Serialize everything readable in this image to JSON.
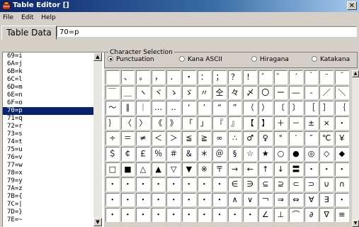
{
  "window": {
    "title": "Table Editor []",
    "close_glyph": "✕"
  },
  "menu": [
    "File",
    "Edit",
    "Help"
  ],
  "tab": {
    "label": "Table Data",
    "value": "70=p"
  },
  "list": {
    "items": [
      "69=i",
      "6A=j",
      "6B=k",
      "6C=l",
      "6D=m",
      "6E=n",
      "6F=o",
      "70=p",
      "71=q",
      "72=r",
      "73=s",
      "74=t",
      "75=u",
      "76=v",
      "77=w",
      "78=x",
      "79=y",
      "7A=z",
      "7B={",
      "7C=|",
      "7D=}",
      "7E=~"
    ],
    "selected_index": 7
  },
  "selection": {
    "group_label": "Character Selection",
    "options": [
      "Punctuation",
      "Kana ASCII",
      "Hiragana",
      "Katakana"
    ],
    "selected_index": 0
  },
  "grid": {
    "rows": [
      [
        "　",
        "、",
        "。",
        "，",
        "．",
        "・",
        "：",
        "；",
        "？",
        "！",
        "゛",
        "゜",
        "´",
        "｀",
        "¨",
        "＾"
      ],
      [
        "￣",
        "＿",
        "ヽ",
        "ヾ",
        "ゝ",
        "ゞ",
        "〃",
        "仝",
        "々",
        "〆",
        "〇",
        "ー",
        "―",
        "‐",
        "／",
        "＼"
      ],
      [
        "～",
        "∥",
        "｜",
        "…",
        "‥",
        "‘",
        "’",
        "“",
        "”",
        "（",
        "）",
        "〔",
        "〕",
        "［",
        "］",
        "｛"
      ],
      [
        "｝",
        "〈",
        "〉",
        "《",
        "》",
        "「",
        "」",
        "『",
        "』",
        "【",
        "】",
        "＋",
        "－",
        "±",
        "×",
        "・"
      ],
      [
        "÷",
        "＝",
        "≠",
        "＜",
        "＞",
        "≦",
        "≧",
        "∞",
        "∴",
        "♂",
        "♀",
        "°",
        "′",
        "″",
        "℃",
        "￥"
      ],
      [
        "＄",
        "￠",
        "￡",
        "％",
        "＃",
        "＆",
        "＊",
        "＠",
        "§",
        "☆",
        "★",
        "○",
        "●",
        "◎",
        "◇",
        "◆"
      ],
      [
        "□",
        "■",
        "△",
        "▲",
        "▽",
        "▼",
        "※",
        "〒",
        "→",
        "←",
        "↑",
        "↓",
        "〓",
        "・",
        "・",
        "・"
      ],
      [
        "・",
        "・",
        "・",
        "・",
        "・",
        "・",
        "・",
        "・",
        "∈",
        "∋",
        "⊆",
        "⊇",
        "⊂",
        "⊃",
        "∪",
        "∩"
      ],
      [
        "・",
        "・",
        "・",
        "・",
        "・",
        "・",
        "・",
        "・",
        "∧",
        "∨",
        "￢",
        "⇒",
        "⇔",
        "∀",
        "∃",
        "・"
      ],
      [
        "・",
        "・",
        "・",
        "・",
        "・",
        "・",
        "・",
        "・",
        "・",
        "・",
        "∠",
        "⊥",
        "⌒",
        "∂",
        "∇",
        "≡"
      ]
    ]
  },
  "icons": {
    "app": "table-editor-app-icon",
    "scroll_up": "▲",
    "scroll_down": "▼"
  }
}
